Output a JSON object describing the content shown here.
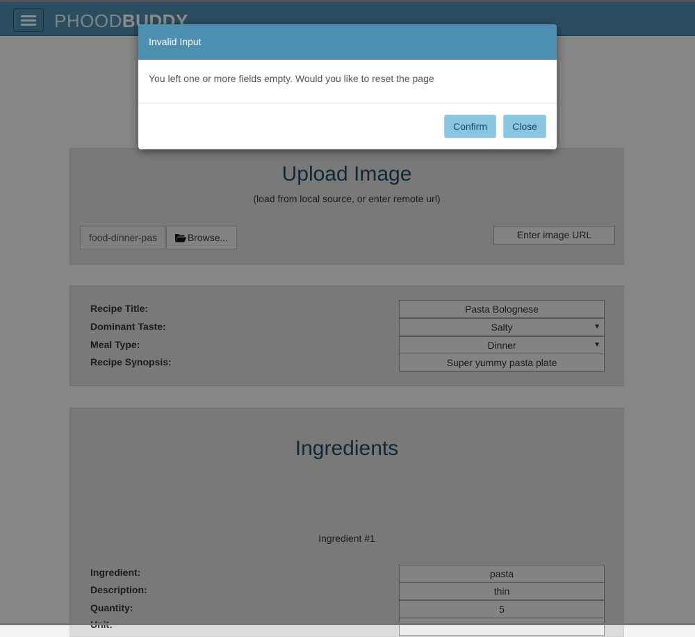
{
  "nav": {
    "brand_part1": "PHOOD",
    "brand_part2": "BUDDY"
  },
  "upload": {
    "title": "Upload Image",
    "subtitle": "(load from local source, or enter remote url)",
    "file_value": "food-dinner-pas",
    "browse_label": "Browse...",
    "url_button_label": "Enter image URL"
  },
  "recipe": {
    "title_label": "Recipe Title:",
    "title_value": "Pasta Bolognese",
    "taste_label": "Dominant Taste:",
    "taste_value": "Salty",
    "meal_label": "Meal Type:",
    "meal_value": "Dinner",
    "synopsis_label": "Recipe Synopsis:",
    "synopsis_value": "Super yummy pasta plate"
  },
  "ingredients": {
    "title": "Ingredients",
    "item_heading": "Ingredient #1",
    "ingredient_label": "Ingredient:",
    "ingredient_value": "pasta",
    "description_label": "Description:",
    "description_value": "thin",
    "quantity_label": "Quantity:",
    "quantity_value": "5",
    "unit_label": "Unit:"
  },
  "modal": {
    "title": "Invalid Input",
    "message": "You left one or more fields empty. Would you like to reset the page",
    "confirm_label": "Confirm",
    "close_label": "Close"
  },
  "colors": {
    "accent": "#4d8fb0",
    "button": "#89c6e2",
    "heading": "#1f4c63"
  }
}
